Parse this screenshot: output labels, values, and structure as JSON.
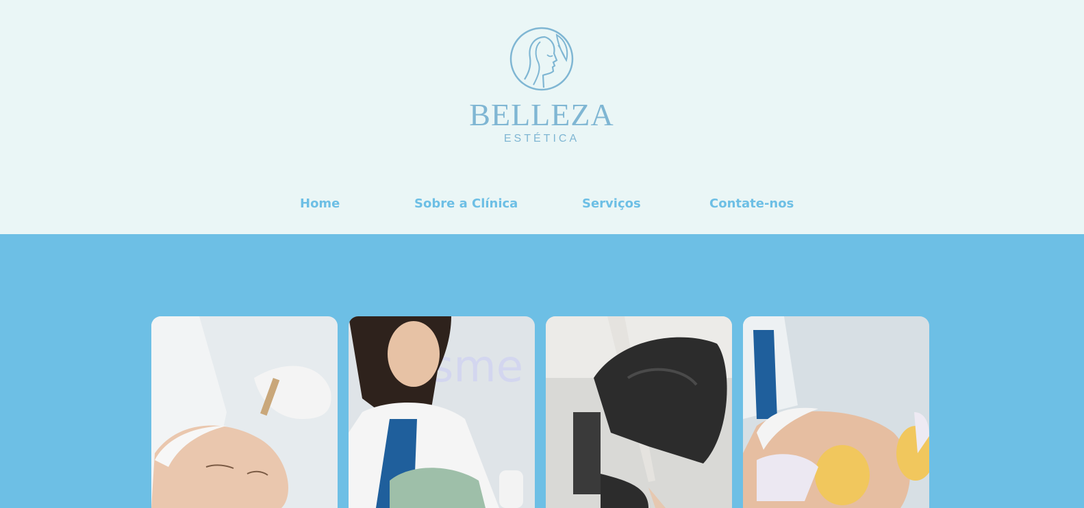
{
  "brand": {
    "name": "BELLEZA",
    "tagline": "ESTÉTICA",
    "logo_icon": "woman-face-profile-icon",
    "color": "#7fb6d3"
  },
  "nav": {
    "items": [
      {
        "label": "Home"
      },
      {
        "label": "Sobre a Clínica"
      },
      {
        "label": "Serviços"
      },
      {
        "label": "Contate-nos"
      }
    ],
    "color": "#6dbfe5"
  },
  "colors": {
    "header_bg": "#eaf6f6",
    "section_bg": "#6dbfe5"
  },
  "gallery": {
    "images": [
      {
        "subject": "facial-serum-dropper-photo"
      },
      {
        "subject": "aesthetician-clay-mask-photo"
      },
      {
        "subject": "gloved-hands-tweezers-photo"
      },
      {
        "subject": "facial-sponge-cleansing-photo"
      }
    ]
  }
}
